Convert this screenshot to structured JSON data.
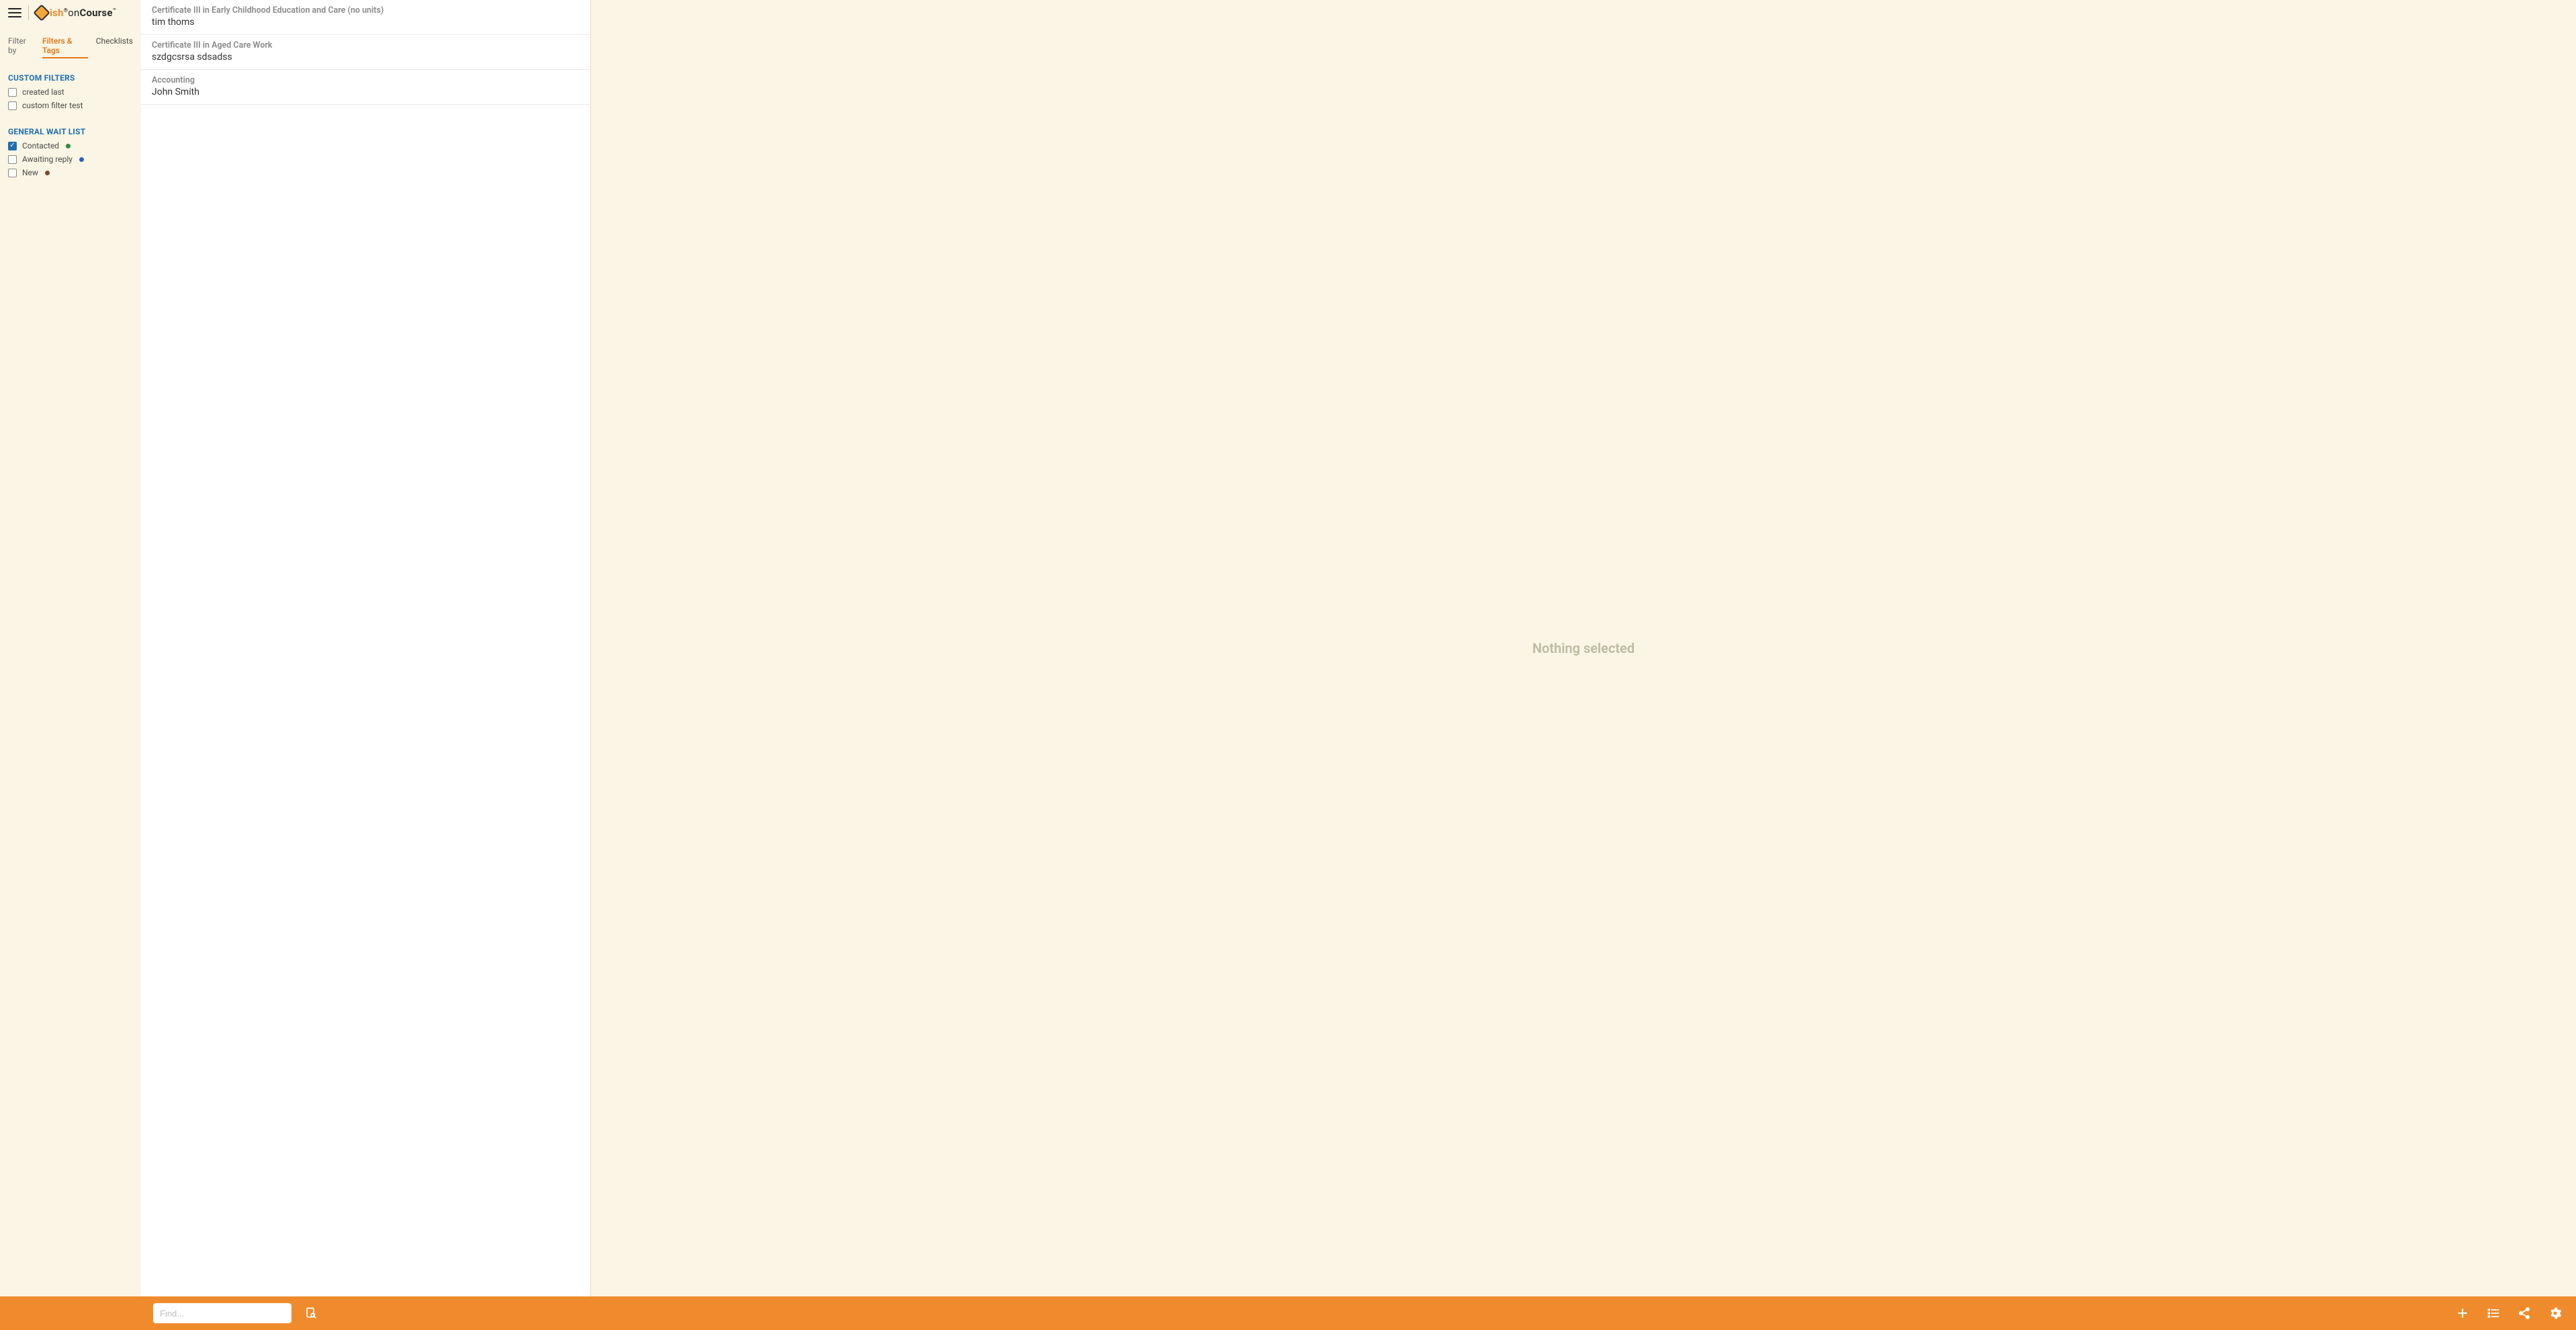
{
  "brand": {
    "ish": "ish",
    "on": "on",
    "course": "Course"
  },
  "sidebar": {
    "filter_by_label": "Filter by",
    "tabs": [
      {
        "label": "Filters & Tags",
        "active": true
      },
      {
        "label": "Checklists",
        "active": false
      }
    ],
    "sections": [
      {
        "title": "CUSTOM FILTERS",
        "items": [
          {
            "label": "created last",
            "checked": false
          },
          {
            "label": "custom filter test",
            "checked": false
          }
        ]
      },
      {
        "title": "GENERAL WAIT LIST",
        "items": [
          {
            "label": "Contacted",
            "checked": true,
            "dot": "#2e8b3b"
          },
          {
            "label": "Awaiting reply",
            "checked": false,
            "dot": "#2a5fd0"
          },
          {
            "label": "New",
            "checked": false,
            "dot": "#7a4a2a"
          }
        ]
      }
    ]
  },
  "list": [
    {
      "title": "Certificate III in Early Childhood Education and Care (no units)",
      "sub": "tim thoms"
    },
    {
      "title": "Certificate III in Aged Care Work",
      "sub": "szdgcsrsa sdsadss"
    },
    {
      "title": "Accounting",
      "sub": "John Smith"
    }
  ],
  "detail": {
    "placeholder": "Nothing selected"
  },
  "bottombar": {
    "search_placeholder": "Find..."
  }
}
